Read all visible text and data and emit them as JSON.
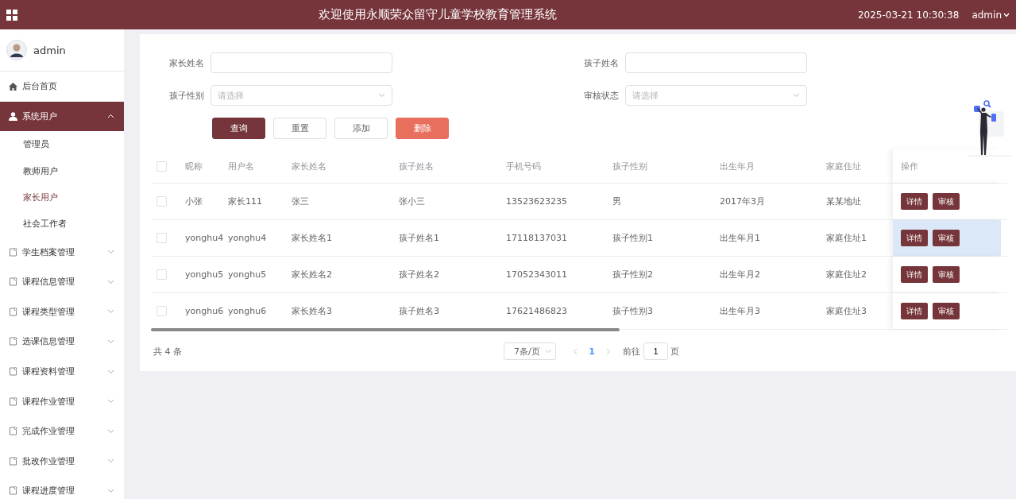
{
  "header": {
    "title": "欢迎使用永顺荣众留守儿童学校教育管理系统",
    "datetime": "2025-03-21 10:30:38",
    "user": "admin"
  },
  "sidebar": {
    "user": "admin",
    "menu": [
      {
        "label": "后台首页",
        "kind": "home",
        "selected": false
      },
      {
        "label": "系统用户",
        "kind": "users",
        "selected": true,
        "expanded": true,
        "children": [
          {
            "label": "管理员",
            "selected": false
          },
          {
            "label": "教师用户",
            "selected": false
          },
          {
            "label": "家长用户",
            "selected": true
          },
          {
            "label": "社会工作者",
            "selected": false
          }
        ]
      },
      {
        "label": "学生档案管理",
        "kind": "group",
        "selected": false,
        "expanded": false
      },
      {
        "label": "课程信息管理",
        "kind": "group",
        "selected": false,
        "expanded": false
      },
      {
        "label": "课程类型管理",
        "kind": "group",
        "selected": false,
        "expanded": false
      },
      {
        "label": "选课信息管理",
        "kind": "group",
        "selected": false,
        "expanded": false
      },
      {
        "label": "课程资料管理",
        "kind": "group",
        "selected": false,
        "expanded": false
      },
      {
        "label": "课程作业管理",
        "kind": "group",
        "selected": false,
        "expanded": false
      },
      {
        "label": "完成作业管理",
        "kind": "group",
        "selected": false,
        "expanded": false
      },
      {
        "label": "批改作业管理",
        "kind": "group",
        "selected": false,
        "expanded": false
      },
      {
        "label": "课程进度管理",
        "kind": "group",
        "selected": false,
        "expanded": false
      }
    ]
  },
  "search": {
    "fields": [
      {
        "label": "家长姓名",
        "kind": "text"
      },
      {
        "label": "孩子姓名",
        "kind": "text"
      },
      {
        "label": "孩子性别",
        "kind": "select",
        "placeholder": "请选择"
      },
      {
        "label": "审核状态",
        "kind": "select",
        "placeholder": "请选择"
      }
    ],
    "buttons": [
      {
        "label": "查询",
        "kind": "primary"
      },
      {
        "label": "重置",
        "kind": "default"
      },
      {
        "label": "添加",
        "kind": "default"
      },
      {
        "label": "删除",
        "kind": "danger"
      }
    ]
  },
  "table": {
    "select_all": {
      "checked": false
    },
    "columns": [
      "昵称",
      "用户名",
      "家长姓名",
      "孩子姓名",
      "手机号码",
      "孩子性别",
      "出生年月",
      "家庭住址",
      "操作"
    ],
    "rows": [
      {
        "checked": false,
        "hovered": false,
        "cells": [
          "小张",
          "家长111",
          "张三",
          "张小三",
          "13523623235",
          "男",
          "2017年3月",
          "某某地址"
        ],
        "actions": [
          "详情",
          "审核"
        ]
      },
      {
        "checked": false,
        "hovered": true,
        "cells": [
          "yonghu4",
          "yonghu4",
          "家长姓名1",
          "孩子姓名1",
          "17118137031",
          "孩子性别1",
          "出生年月1",
          "家庭住址1"
        ],
        "actions": [
          "详情",
          "审核"
        ]
      },
      {
        "checked": false,
        "hovered": false,
        "cells": [
          "yonghu5",
          "yonghu5",
          "家长姓名2",
          "孩子姓名2",
          "17052343011",
          "孩子性别2",
          "出生年月2",
          "家庭住址2"
        ],
        "actions": [
          "详情",
          "审核"
        ]
      },
      {
        "checked": false,
        "hovered": false,
        "cells": [
          "yonghu6",
          "yonghu6",
          "家长姓名3",
          "孩子姓名3",
          "17621486823",
          "孩子性别3",
          "出生年月3",
          "家庭住址3"
        ],
        "actions": [
          "详情",
          "审核"
        ]
      }
    ]
  },
  "pagination": {
    "total": "共 4 条",
    "page_size": "7条/页",
    "pages": [
      {
        "label": "1",
        "selected": true
      }
    ],
    "jump_label": "前往",
    "jump_value": "1",
    "jump_suffix": "页"
  }
}
